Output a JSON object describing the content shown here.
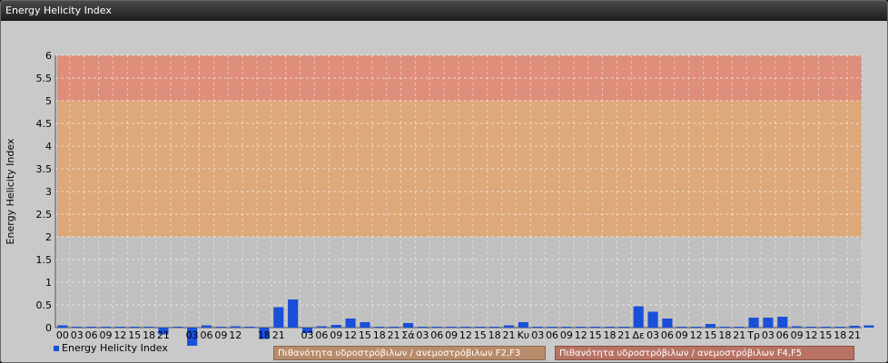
{
  "window": {
    "title": "Energy Helicity Index"
  },
  "colors": {
    "bar": "#1a4fd8",
    "zone_low": "#c0c0c0",
    "zone_mid": "#e2a56d",
    "zone_high": "#e4856e",
    "band1": "#b88b6a",
    "band2": "#b87365"
  },
  "chart_data": {
    "type": "bar",
    "ylabel": "Energy Helicity Index",
    "xlabel": "",
    "ylim": [
      0,
      6
    ],
    "yticks": [
      "0",
      "0.5",
      "1",
      "1.5",
      "2",
      "2.5",
      "3",
      "3.5",
      "4",
      "4.5",
      "5",
      "5.5",
      "6"
    ],
    "grid": true,
    "zones": [
      {
        "from": 0,
        "to": 2,
        "color": "#c0c0c0"
      },
      {
        "from": 2,
        "to": 5,
        "color": "#e2a56d"
      },
      {
        "from": 5,
        "to": 6,
        "color": "#e4856e"
      }
    ],
    "categories": [
      "00",
      "03",
      "06",
      "09",
      "12",
      "15",
      "18",
      "21",
      "",
      "03",
      "06",
      "09",
      "12",
      "",
      "18",
      "21",
      "",
      "03",
      "06",
      "09",
      "12",
      "15",
      "18",
      "21",
      "Σά",
      "03",
      "06",
      "09",
      "12",
      "15",
      "18",
      "21",
      "Κυ",
      "03",
      "06",
      "09",
      "12",
      "15",
      "18",
      "21",
      "Δε",
      "03",
      "06",
      "09",
      "12",
      "15",
      "18",
      "21",
      "Τρ",
      "03",
      "06",
      "09",
      "12",
      "15",
      "18",
      "21"
    ],
    "series": [
      {
        "name": "Energy Helicity Index",
        "values": [
          0.05,
          0.02,
          0.02,
          0.02,
          0.02,
          0.02,
          0.02,
          -0.15,
          0.02,
          -0.4,
          0.05,
          0.02,
          0.03,
          0.02,
          -0.25,
          0.45,
          0.62,
          -0.12,
          0.03,
          0.06,
          0.2,
          0.12,
          0.02,
          0.02,
          0.1,
          0.02,
          0.02,
          0.02,
          0.02,
          0.02,
          0.02,
          0.05,
          0.12,
          0.02,
          0.02,
          0.02,
          0.02,
          0.02,
          0.02,
          0.02,
          0.47,
          0.35,
          0.2,
          0.02,
          0.02,
          0.08,
          0.02,
          0.02,
          0.22,
          0.22,
          0.24,
          0.03,
          0.02,
          0.02,
          0.02,
          0.04,
          0.05
        ]
      }
    ],
    "legend_position": "bottom-left"
  },
  "legend": {
    "label": "Energy Helicity Index"
  },
  "bands": [
    {
      "label": "Πιθανότητα υδροστρόβιλων / ανεμοστρόβιλων F2,F3"
    },
    {
      "label": "Πιθανότητα υδροστρόβιλων / ανεμοστρόβιλων F4,F5"
    }
  ]
}
